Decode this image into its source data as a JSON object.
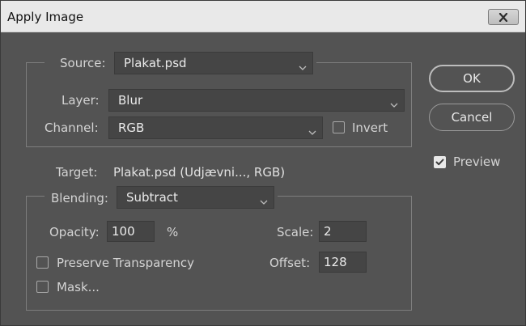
{
  "window": {
    "title": "Apply Image"
  },
  "icons": {
    "close": "close-icon",
    "dropdown": "chevron-down-icon",
    "check": "checkmark-icon"
  },
  "source": {
    "label": "Source:",
    "value": "Plakat.psd"
  },
  "layer": {
    "label": "Layer:",
    "value": "Blur"
  },
  "channel": {
    "label": "Channel:",
    "value": "RGB",
    "invert_label": "Invert",
    "invert_checked": false
  },
  "target": {
    "label": "Target:",
    "value": "Plakat.psd (Udjævni..., RGB)"
  },
  "blending": {
    "label": "Blending:",
    "value": "Subtract",
    "opacity_label": "Opacity:",
    "opacity_value": "100",
    "opacity_unit": "%",
    "scale_label": "Scale:",
    "scale_value": "2",
    "offset_label": "Offset:",
    "offset_value": "128",
    "preserve_transparency_label": "Preserve Transparency",
    "preserve_transparency_checked": false,
    "mask_label": "Mask...",
    "mask_checked": false
  },
  "buttons": {
    "ok_label": "OK",
    "cancel_label": "Cancel"
  },
  "preview": {
    "label": "Preview",
    "checked": true
  },
  "colors": {
    "dialog_bg": "#535353",
    "titlebar_bg": "#e9e9e9",
    "field_bg": "#454545"
  }
}
